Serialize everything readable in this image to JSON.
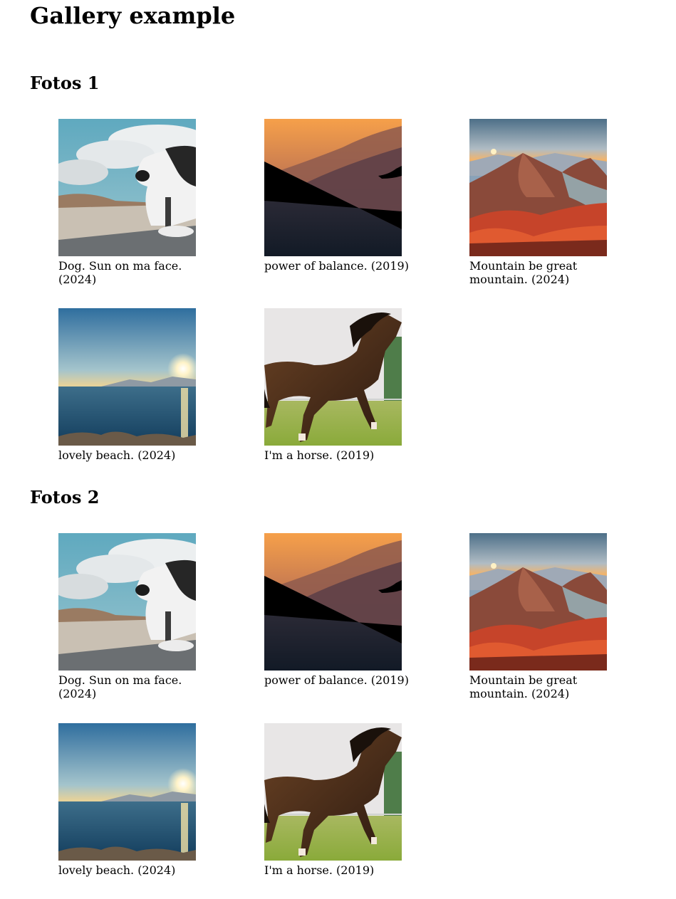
{
  "page": {
    "title": "Gallery example"
  },
  "sections": [
    {
      "title": "Fotos 1",
      "items": [
        {
          "caption": "Dog. Sun on ma face. (2024)",
          "image": "dog-in-car-window"
        },
        {
          "caption": "power of balance. (2019)",
          "image": "sunset-mountain-silhouette"
        },
        {
          "caption": "Mountain be great mountain. (2024)",
          "image": "red-mountain-sunrise"
        },
        {
          "caption": "lovely beach. (2024)",
          "image": "sea-sunset"
        },
        {
          "caption": "I'm a horse. (2019)",
          "image": "galloping-horse"
        }
      ]
    },
    {
      "title": "Fotos 2",
      "items": [
        {
          "caption": "Dog. Sun on ma face. (2024)",
          "image": "dog-in-car-window"
        },
        {
          "caption": "power of balance. (2019)",
          "image": "sunset-mountain-silhouette"
        },
        {
          "caption": "Mountain be great mountain. (2024)",
          "image": "red-mountain-sunrise"
        },
        {
          "caption": "lovely beach. (2024)",
          "image": "sea-sunset"
        },
        {
          "caption": "I'm a horse. (2019)",
          "image": "galloping-horse"
        }
      ]
    }
  ]
}
